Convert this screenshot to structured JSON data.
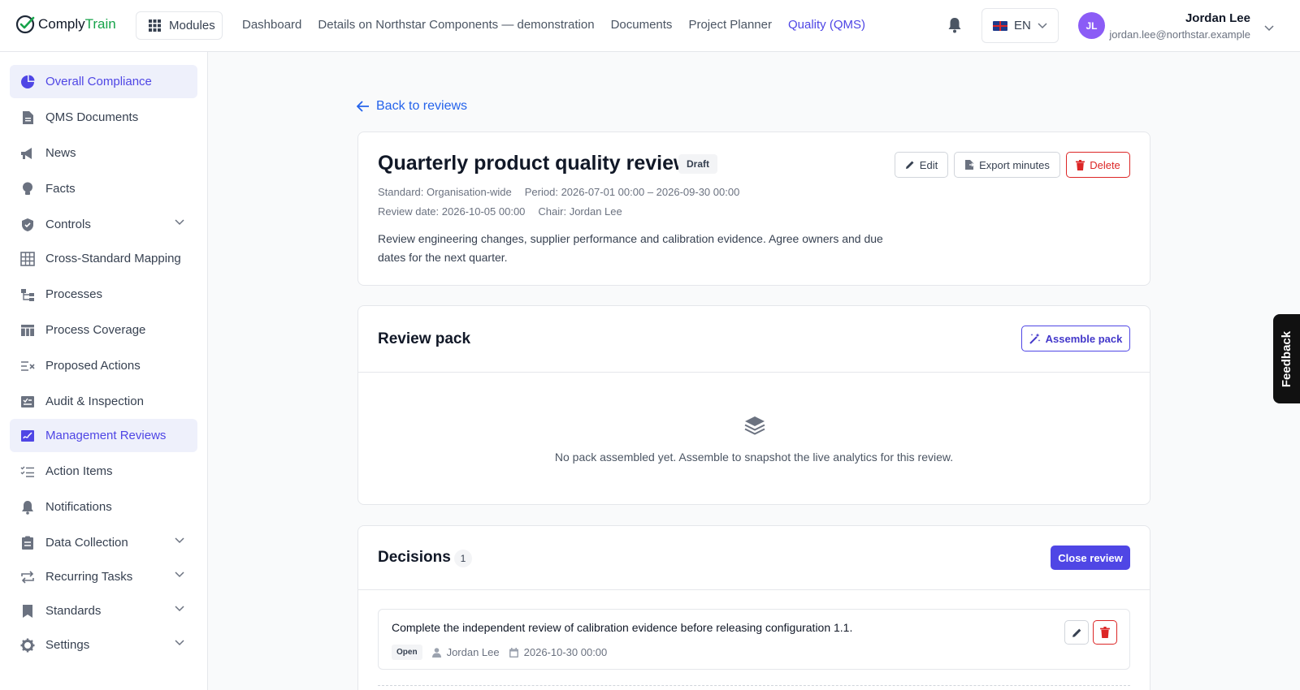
{
  "brand": {
    "name_part1": "Comply",
    "name_part2": "Train"
  },
  "topbar": {
    "modules_label": "Modules",
    "nav": [
      "Dashboard",
      "Details on Northstar Components — demonstration",
      "Documents",
      "Project Planner",
      "Quality (QMS)"
    ],
    "active_nav": "Quality (QMS)",
    "language": "EN",
    "user": {
      "initials": "JL",
      "name": "Jordan Lee",
      "email": "jordan.lee@northstar.example"
    }
  },
  "sidebar": {
    "items": [
      {
        "label": "Overall Compliance",
        "icon": "pie-chart-icon",
        "active": true,
        "expandable": false
      },
      {
        "label": "QMS Documents",
        "icon": "document-icon",
        "active": false,
        "expandable": false
      },
      {
        "label": "News",
        "icon": "megaphone-icon",
        "active": false,
        "expandable": false
      },
      {
        "label": "Facts",
        "icon": "lightbulb-icon",
        "active": false,
        "expandable": false
      },
      {
        "label": "Controls",
        "icon": "shield-check-icon",
        "active": false,
        "expandable": true
      },
      {
        "label": "Cross-Standard Mapping",
        "icon": "grid-icon",
        "active": false,
        "expandable": false
      },
      {
        "label": "Processes",
        "icon": "flowchart-icon",
        "active": false,
        "expandable": false
      },
      {
        "label": "Process Coverage",
        "icon": "table-icon",
        "active": false,
        "expandable": false
      },
      {
        "label": "Proposed Actions",
        "icon": "checklist-x-icon",
        "active": false,
        "expandable": false
      },
      {
        "label": "Audit & Inspection",
        "icon": "clipboard-check-icon",
        "active": false,
        "expandable": false
      },
      {
        "label": "Management Reviews",
        "icon": "signature-icon",
        "active": true,
        "expandable": false
      },
      {
        "label": "Action Items",
        "icon": "task-list-icon",
        "active": false,
        "expandable": false
      },
      {
        "label": "Notifications",
        "icon": "bell-icon",
        "active": false,
        "expandable": false
      },
      {
        "label": "Data Collection",
        "icon": "clipboard-icon",
        "active": false,
        "expandable": true
      },
      {
        "label": "Recurring Tasks",
        "icon": "repeat-icon",
        "active": false,
        "expandable": true
      },
      {
        "label": "Standards",
        "icon": "bookmark-icon",
        "active": false,
        "expandable": true
      },
      {
        "label": "Settings",
        "icon": "gear-icon",
        "active": false,
        "expandable": true
      }
    ]
  },
  "main": {
    "back_label": "Back to reviews",
    "review": {
      "title": "Quarterly product quality review",
      "status": "Draft",
      "standard": "Standard: Organisation-wide",
      "period": "Period: 2026-07-01 00:00 – 2026-09-30 00:00",
      "review_date": "Review date: 2026-10-05 00:00",
      "chair": "Chair: Jordan Lee",
      "description": "Review engineering changes, supplier performance and calibration evidence. Agree owners and due dates for the next quarter.",
      "edit_label": "Edit",
      "export_label": "Export minutes",
      "delete_label": "Delete"
    },
    "pack": {
      "title": "Review pack",
      "assemble_label": "Assemble pack",
      "empty_text": "No pack assembled yet. Assemble to snapshot the live analytics for this review."
    },
    "decisions": {
      "title": "Decisions",
      "count": "1",
      "close_label": "Close review",
      "items": [
        {
          "text": "Complete the independent review of calibration evidence before releasing configuration 1.1.",
          "status": "Open",
          "owner": "Jordan Lee",
          "due": "2026-10-30 00:00"
        }
      ]
    }
  },
  "feedback_label": "Feedback",
  "colors": {
    "accent": "#4f46e5",
    "danger": "#dc2626",
    "brand_green": "#16a34a",
    "link": "#2563eb"
  }
}
